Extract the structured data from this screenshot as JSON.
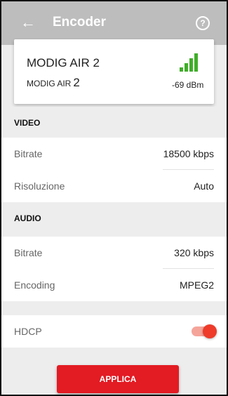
{
  "appbar": {
    "back_icon": "arrow-left-icon",
    "title": "Encoder",
    "help_icon": "help-circle-icon",
    "help_glyph": "?"
  },
  "device": {
    "name": "MODIG AIR 2",
    "sub_prefix": "MODIG AIR",
    "sub_number": "2",
    "signal_icon": "signal-strength-icon",
    "signal_color": "#3fae29",
    "rssi": "-69 dBm"
  },
  "video": {
    "header": "VIDEO",
    "rows": [
      {
        "label": "Bitrate",
        "value": "18500 kbps"
      },
      {
        "label": "Risoluzione",
        "value": "Auto"
      }
    ]
  },
  "audio": {
    "header": "AUDIO",
    "rows": [
      {
        "label": "Bitrate",
        "value": "320 kbps"
      },
      {
        "label": "Encoding",
        "value": "MPEG2"
      }
    ]
  },
  "hdcp": {
    "label": "HDCP",
    "enabled": true,
    "accent": "#ee3b2a"
  },
  "actions": {
    "apply_label": "APPLICA",
    "apply_color": "#e31b23"
  }
}
